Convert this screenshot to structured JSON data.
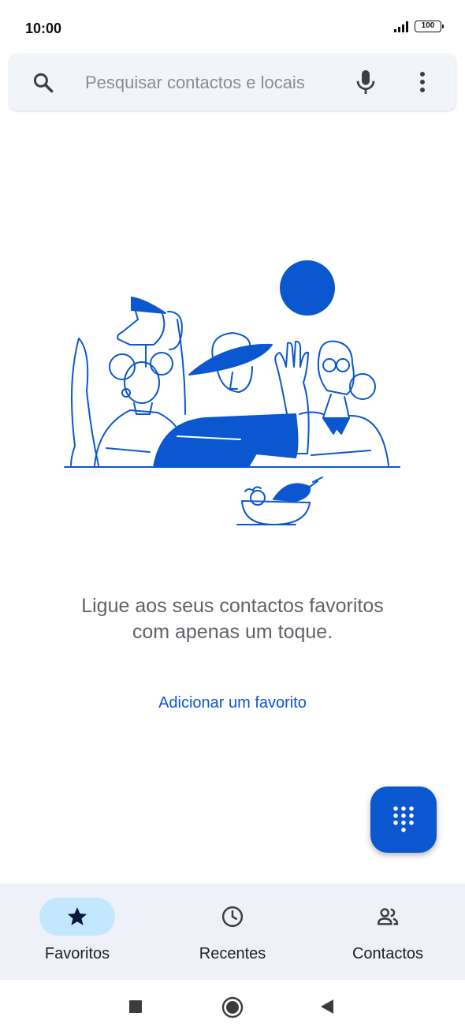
{
  "status_bar": {
    "time": "10:00",
    "battery": "100"
  },
  "search": {
    "placeholder": "Pesquisar contactos e locais"
  },
  "empty_state": {
    "message": "Ligue aos seus contactos favoritos com apenas um toque.",
    "action_label": "Adicionar um favorito"
  },
  "fab": {
    "icon": "dialpad-icon"
  },
  "bottom_nav": {
    "items": [
      {
        "label": "Favoritos",
        "icon": "star-icon",
        "active": true
      },
      {
        "label": "Recentes",
        "icon": "clock-icon",
        "active": false
      },
      {
        "label": "Contactos",
        "icon": "people-icon",
        "active": false
      }
    ]
  },
  "colors": {
    "accent": "#0b57d0",
    "active_pill": "#c2e7ff",
    "nav_bg": "#eef1f8",
    "search_bg": "#f1f4f9"
  }
}
